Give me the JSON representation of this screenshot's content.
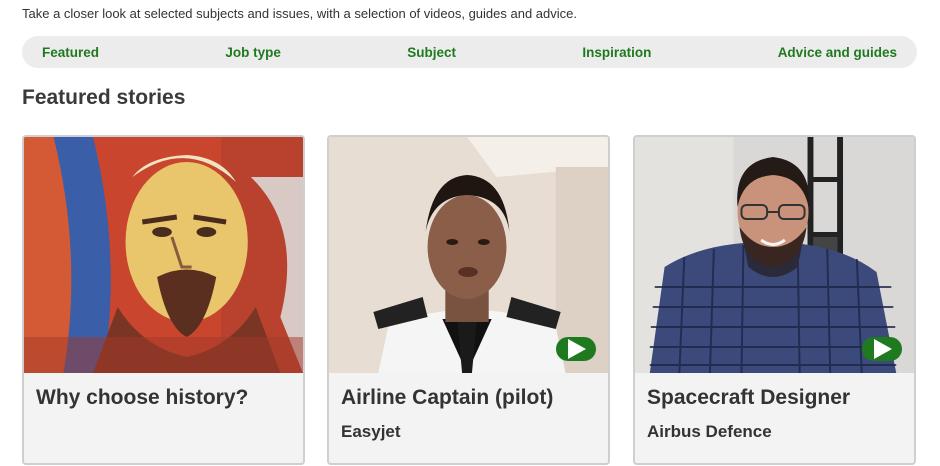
{
  "intro": "Take a closer look at selected subjects and issues, with a selection of videos, guides and advice.",
  "tabs": [
    "Featured",
    "Job type",
    "Subject",
    "Inspiration",
    "Advice and guides"
  ],
  "section_title": "Featured stories",
  "cards": [
    {
      "title": "Why choose history?",
      "subtitle": "",
      "video": false,
      "image": "mosaic-portrait"
    },
    {
      "title": "Airline Captain (pilot)",
      "subtitle": "Easyjet",
      "video": true,
      "image": "pilot-photo"
    },
    {
      "title": "Spacecraft Designer",
      "subtitle": "Airbus Defence",
      "video": true,
      "image": "designer-photo"
    }
  ],
  "colors": {
    "accent": "#1f7a1f",
    "tab_bar": "#ececec",
    "card_bg": "#f3f3f3"
  },
  "icons": {
    "play": "play-icon"
  }
}
